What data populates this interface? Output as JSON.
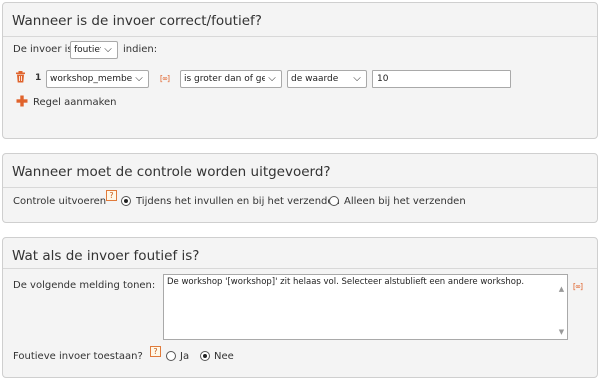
{
  "section1": {
    "title": "Wanneer is de invoer correct/foutief?",
    "prefix_label": "De invoer is",
    "state_select": "foutief",
    "suffix_label": "indien:",
    "rule": {
      "number": "1",
      "field_select": "workshop_members",
      "operator_select": "is groter dan of gelijk a",
      "compare_select": "de waarde",
      "value_input": "10"
    },
    "add_rule_label": "Regel aanmaken",
    "var_icon_glyph": "[∞]",
    "trash_icon": "trash-icon",
    "plus_icon": "plus-icon"
  },
  "section2": {
    "title": "Wanneer moet de controle worden uitgevoerd?",
    "label": "Controle uitvoeren",
    "help_glyph": "?",
    "option_1": "Tijdens het invullen en bij het verzenden",
    "option_2": "Alleen bij het verzenden",
    "selected": 1
  },
  "section3": {
    "title": "Wat als de invoer foutief is?",
    "message_label": "De volgende melding tonen:",
    "message_text": "De workshop '[workshop]' zit helaas vol. Selecteer alstublieft een andere workshop.",
    "allow_label": "Foutieve invoer toestaan?",
    "help_glyph": "?",
    "option_yes": "Ja",
    "option_no": "Nee",
    "selected": "Nee"
  },
  "colors": {
    "accent_orange": "#e0632c",
    "panel_bg": "#f4f4f4",
    "panel_border": "#cfcfcf"
  }
}
